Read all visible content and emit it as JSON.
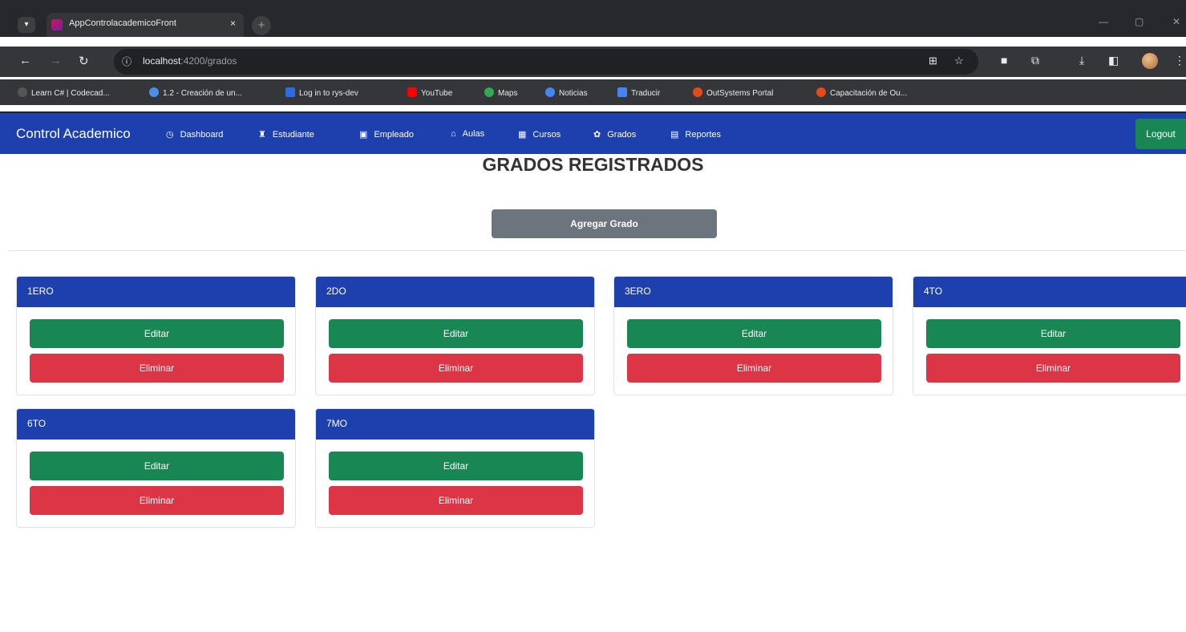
{
  "browser": {
    "tab_title": "AppControlacademicoFront",
    "tab_close": "×",
    "new_tab": "+",
    "url_host": "localhost",
    "url_path": ":4200/grados",
    "bookmarks": [
      {
        "label": "Learn C# | Codecad...",
        "color": "#555555"
      },
      {
        "label": "1.2 - Creación de un...",
        "color": "#4a90e2"
      },
      {
        "label": "Log in to rys-dev",
        "color": "#2d6cdf"
      },
      {
        "label": "YouTube",
        "color": "#ff0000"
      },
      {
        "label": "Maps",
        "color": "#34a853"
      },
      {
        "label": "Noticias",
        "color": "#4285f4"
      },
      {
        "label": "Traducir",
        "color": "#4285f4"
      },
      {
        "label": "OutSystems Portal",
        "color": "#e64a19"
      },
      {
        "label": "Capacitación de Ou...",
        "color": "#e64a19"
      }
    ]
  },
  "navbar": {
    "brand": "Control Academico",
    "items": [
      {
        "label": "Dashboard",
        "icon": "dashboard-icon"
      },
      {
        "label": "Estudiante",
        "icon": "student-icon"
      },
      {
        "label": "Empleado",
        "icon": "employee-icon"
      },
      {
        "label": "Aulas",
        "icon": "classroom-icon"
      },
      {
        "label": "Cursos",
        "icon": "courses-icon"
      },
      {
        "label": "Grados",
        "icon": "grades-icon"
      },
      {
        "label": "Reportes",
        "icon": "reports-icon"
      }
    ],
    "logout": "Logout"
  },
  "main": {
    "title": "GRADOS REGISTRADOS",
    "add_button": "Agregar Grado",
    "cards": [
      {
        "name": "1ERO",
        "edit": "Editar",
        "delete": "Eliminar"
      },
      {
        "name": "2DO",
        "edit": "Editar",
        "delete": "Eliminar"
      },
      {
        "name": "3ERO",
        "edit": "Editar",
        "delete": "Eliminar"
      },
      {
        "name": "4TO",
        "edit": "Editar",
        "delete": "Eliminar"
      },
      {
        "name": "6TO",
        "edit": "Editar",
        "delete": "Eliminar"
      },
      {
        "name": "7MO",
        "edit": "Editar",
        "delete": "Eliminar"
      }
    ]
  },
  "colors": {
    "navbar": "#1e40af",
    "card_header": "#1e40af",
    "edit": "#198754",
    "delete": "#dc3545",
    "add": "#6c757d",
    "logout": "#198754"
  }
}
